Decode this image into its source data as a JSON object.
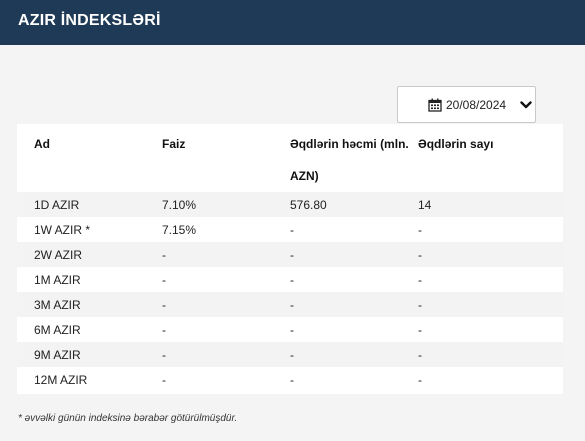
{
  "header": {
    "title": "AZIR İNDEKSLƏRİ"
  },
  "date_picker": {
    "value": "20/08/2024",
    "calendar_icon": "calendar-icon",
    "dropdown_icon": "chevron-down-icon"
  },
  "table": {
    "columns": [
      "Ad",
      "Faiz",
      "Əqdlərin həcmi (mln. AZN)",
      "Əqdlərin sayı"
    ],
    "rows": [
      [
        "1D AZIR",
        "7.10%",
        "576.80",
        "14"
      ],
      [
        "1W AZIR *",
        "7.15%",
        "-",
        "-"
      ],
      [
        "2W AZIR",
        "-",
        "-",
        "-"
      ],
      [
        "1M AZIR",
        "-",
        "-",
        "-"
      ],
      [
        "3M AZIR",
        "-",
        "-",
        "-"
      ],
      [
        "6M AZIR",
        "-",
        "-",
        "-"
      ],
      [
        "9M AZIR",
        "-",
        "-",
        "-"
      ],
      [
        "12M AZIR",
        "-",
        "-",
        "-"
      ]
    ]
  },
  "footnote": "* əvvəlki günün indeksinə bərabər götürülmüşdür.",
  "colors": {
    "header_bg": "#1f3a56",
    "page_bg": "#f4f4f4",
    "row_alt": "#f3f3f3"
  }
}
